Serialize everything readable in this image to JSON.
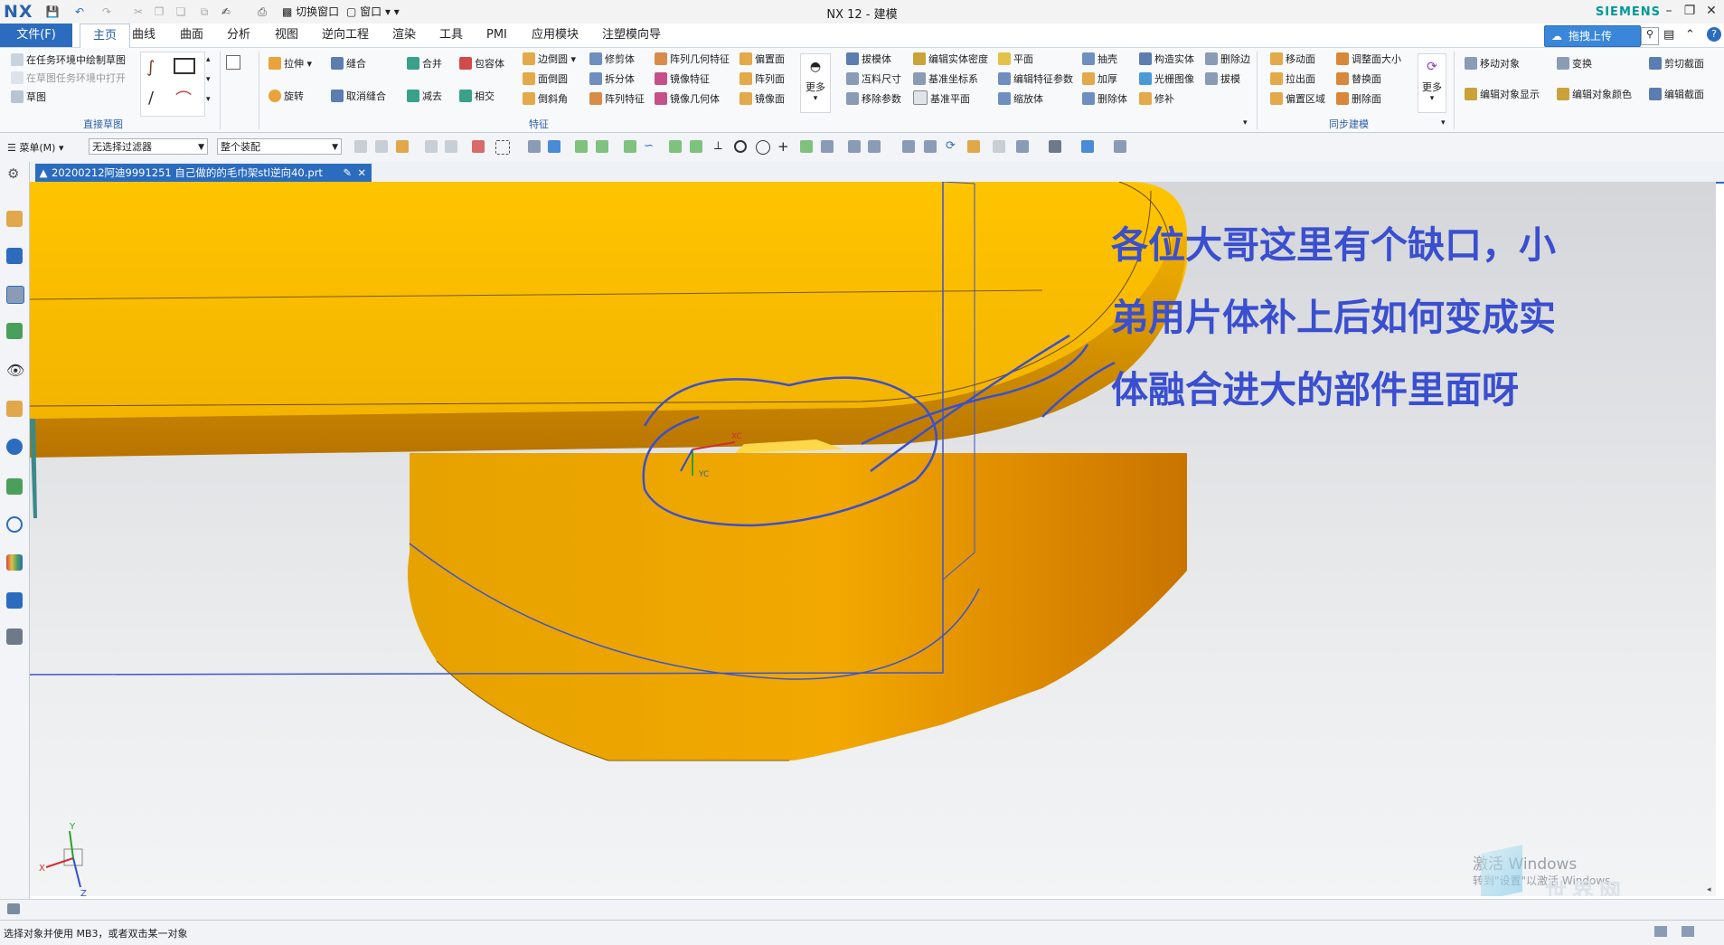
{
  "app": {
    "logo": "NX",
    "window_title": "NX 12 - 建模",
    "brand": "SIEMENS",
    "upload_label": "拖拽上传"
  },
  "menu": {
    "file": "文件(F)",
    "tabs": [
      "主页",
      "曲线",
      "曲面",
      "分析",
      "视图",
      "逆向工程",
      "渲染",
      "工具",
      "PMI",
      "应用模块",
      "注塑模向导"
    ]
  },
  "ribbon": {
    "sketch_group": {
      "label": "直接草图",
      "items": [
        "在任务环境中绘制草图",
        "在草图任务环境中打开",
        "草图"
      ]
    },
    "feature_group": {
      "label": "特征",
      "big": [
        "拉伸",
        "旋转",
        "缝合",
        "取消缝合",
        "合并",
        "减去",
        "包容体",
        "相交"
      ],
      "col1": [
        "边倒圆",
        "面倒圆",
        "倒斜角"
      ],
      "col2": [
        "修剪体",
        "拆分体",
        "阵列特征"
      ],
      "col3": [
        "阵列几何特征",
        "镜像特征",
        "镜像几何体"
      ],
      "col4": [
        "偏置面",
        "阵列面",
        "镜像面"
      ],
      "more": "更多",
      "col5": [
        "拔模体",
        "冱料尺寸",
        "移除参数"
      ],
      "col6": [
        "编辑实体密度",
        "基准坐标系",
        "基准平面"
      ],
      "col7": [
        "平面",
        "编辑特征参数",
        "缩放体"
      ],
      "col8": [
        "抽壳",
        "加厚",
        "删除体"
      ],
      "col9": [
        "构造实体",
        "光栅图像",
        "修补"
      ],
      "col10": [
        "删除边",
        "拔模"
      ]
    },
    "sync_group": {
      "label": "同步建模",
      "col1": [
        "移动面",
        "拉出面",
        "偏置区域"
      ],
      "col2": [
        "调整面大小",
        "替换面",
        "删除面"
      ],
      "more": "更多"
    },
    "right_items": [
      "移动对象",
      "编辑对象显示",
      "变换",
      "编辑对象颜色",
      "剪切截面",
      "编辑截面"
    ]
  },
  "toolbar2": {
    "menu_label": "菜单(M)",
    "filter": "无选择过滤器",
    "assembly": "整个装配"
  },
  "document_tab": {
    "title": "20200212阿迪9991251   自己做的的毛巾架stl逆向40.prt"
  },
  "viewport": {
    "annotation_lines": [
      "各位大哥这里有个缺口，小",
      "弟用片体补上后如何变成实",
      "体融合进大的部件里面呀"
    ],
    "csys_labels": [
      "XC",
      "YC"
    ],
    "triad_labels": [
      "X",
      "Y",
      "Z"
    ],
    "watermark_line1": "激活 Windows",
    "watermark_line2": "转到\"设置\"以激活 Windows。",
    "site_watermark": "世界网"
  },
  "status_bar": {
    "prompt": "选择对象并使用 MB3，或者双击某一对象"
  },
  "colors": {
    "accent": "#2b6cbf",
    "part_yellow": "#f7b500",
    "annotation": "#3a4fcf"
  }
}
